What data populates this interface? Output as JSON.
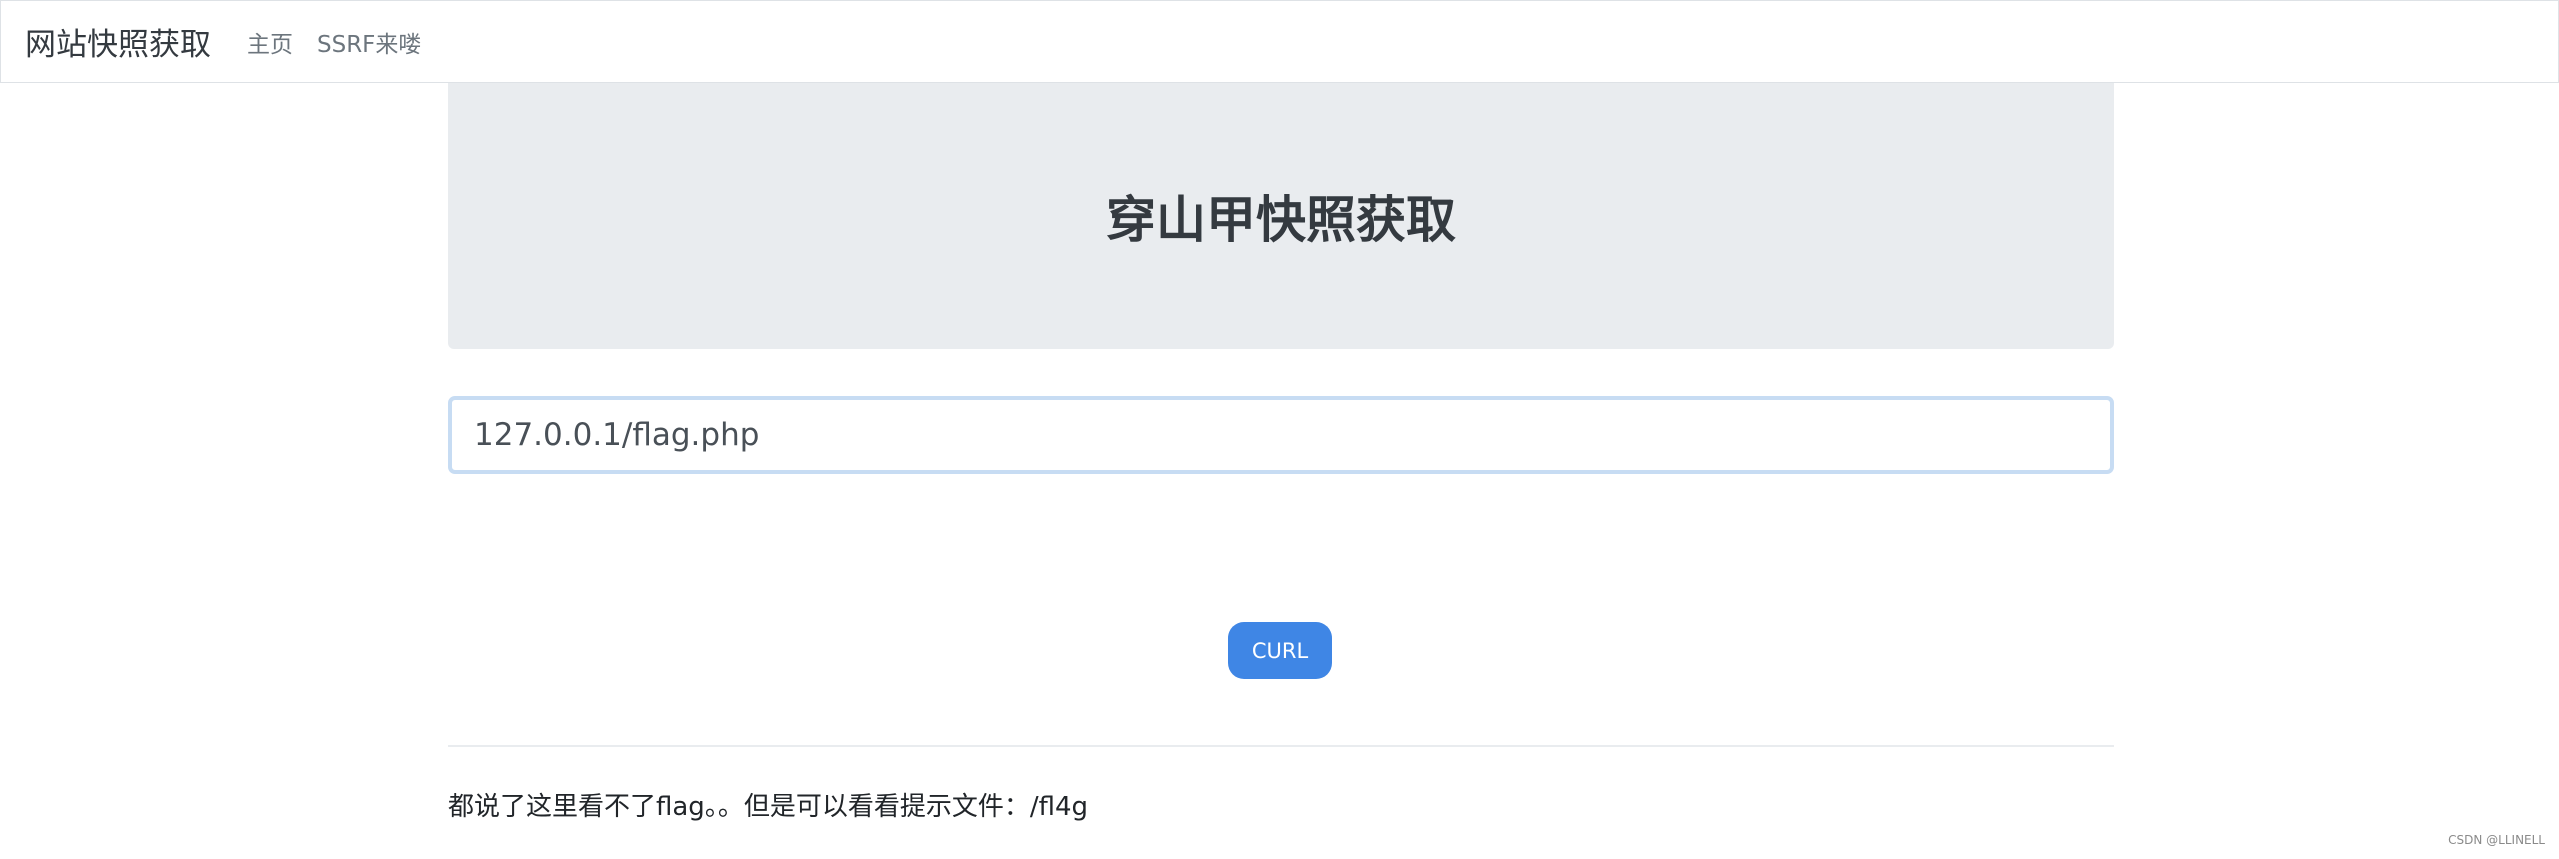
{
  "navbar": {
    "brand": "网站快照获取",
    "links": [
      {
        "label": "主页"
      },
      {
        "label": "SSRF来喽"
      }
    ]
  },
  "hero": {
    "title": "穿山甲快照获取"
  },
  "form": {
    "url_value": "127.0.0.1/flag.php",
    "submit_label": "CURL"
  },
  "hint": {
    "text": "都说了这里看不了flag。。但是可以看看提示文件：/fl4g"
  },
  "watermark": {
    "text": "CSDN @LLINELL"
  },
  "colors": {
    "button": "#3f86e5",
    "jumbotron": "#e9ecef",
    "input_focus_border": "#c7dcf3"
  }
}
